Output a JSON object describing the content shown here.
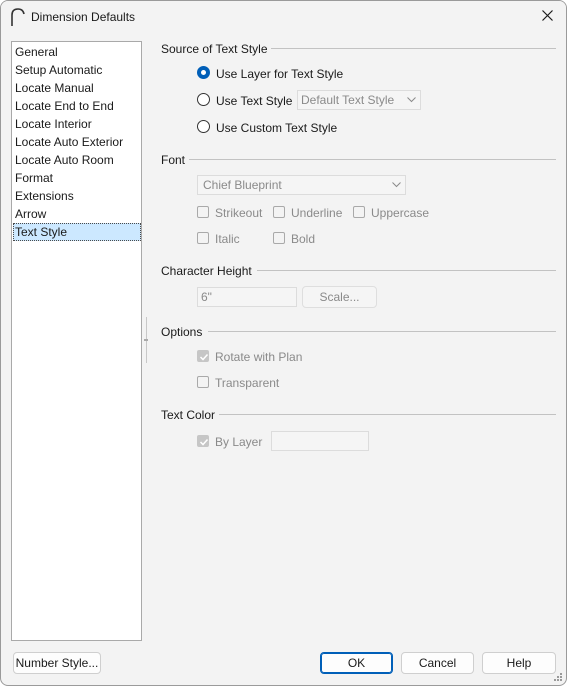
{
  "window": {
    "title": "Dimension Defaults"
  },
  "nav": {
    "items": [
      {
        "label": "General"
      },
      {
        "label": "Setup Automatic"
      },
      {
        "label": "Locate Manual"
      },
      {
        "label": "Locate End to End"
      },
      {
        "label": "Locate Interior"
      },
      {
        "label": "Locate Auto Exterior"
      },
      {
        "label": "Locate Auto Room"
      },
      {
        "label": "Format"
      },
      {
        "label": "Extensions"
      },
      {
        "label": "Arrow"
      },
      {
        "label": "Text Style"
      }
    ],
    "selected": "Text Style"
  },
  "source": {
    "title": "Source of Text Style",
    "option_layer": "Use Layer for Text Style",
    "option_text_style": "Use Text Style",
    "text_style_value": "Default Text Style",
    "option_custom": "Use Custom Text Style",
    "selected": "Use Layer for Text Style"
  },
  "font": {
    "title": "Font",
    "font_value": "Chief Blueprint",
    "strikeout": "Strikeout",
    "underline": "Underline",
    "uppercase": "Uppercase",
    "italic": "Italic",
    "bold": "Bold"
  },
  "character_height": {
    "title": "Character Height",
    "value": "6\"",
    "scale_button": "Scale..."
  },
  "options": {
    "title": "Options",
    "rotate_with_plan": "Rotate with Plan",
    "rotate_checked": true,
    "transparent": "Transparent",
    "transparent_checked": false
  },
  "text_color": {
    "title": "Text Color",
    "by_layer": "By Layer",
    "by_layer_checked": true
  },
  "footer": {
    "number_style": "Number Style...",
    "ok": "OK",
    "cancel": "Cancel",
    "help": "Help"
  },
  "colors": {
    "accent": "#005fb8",
    "selection": "#cce8ff",
    "disabled_text": "#8a8a8a"
  }
}
